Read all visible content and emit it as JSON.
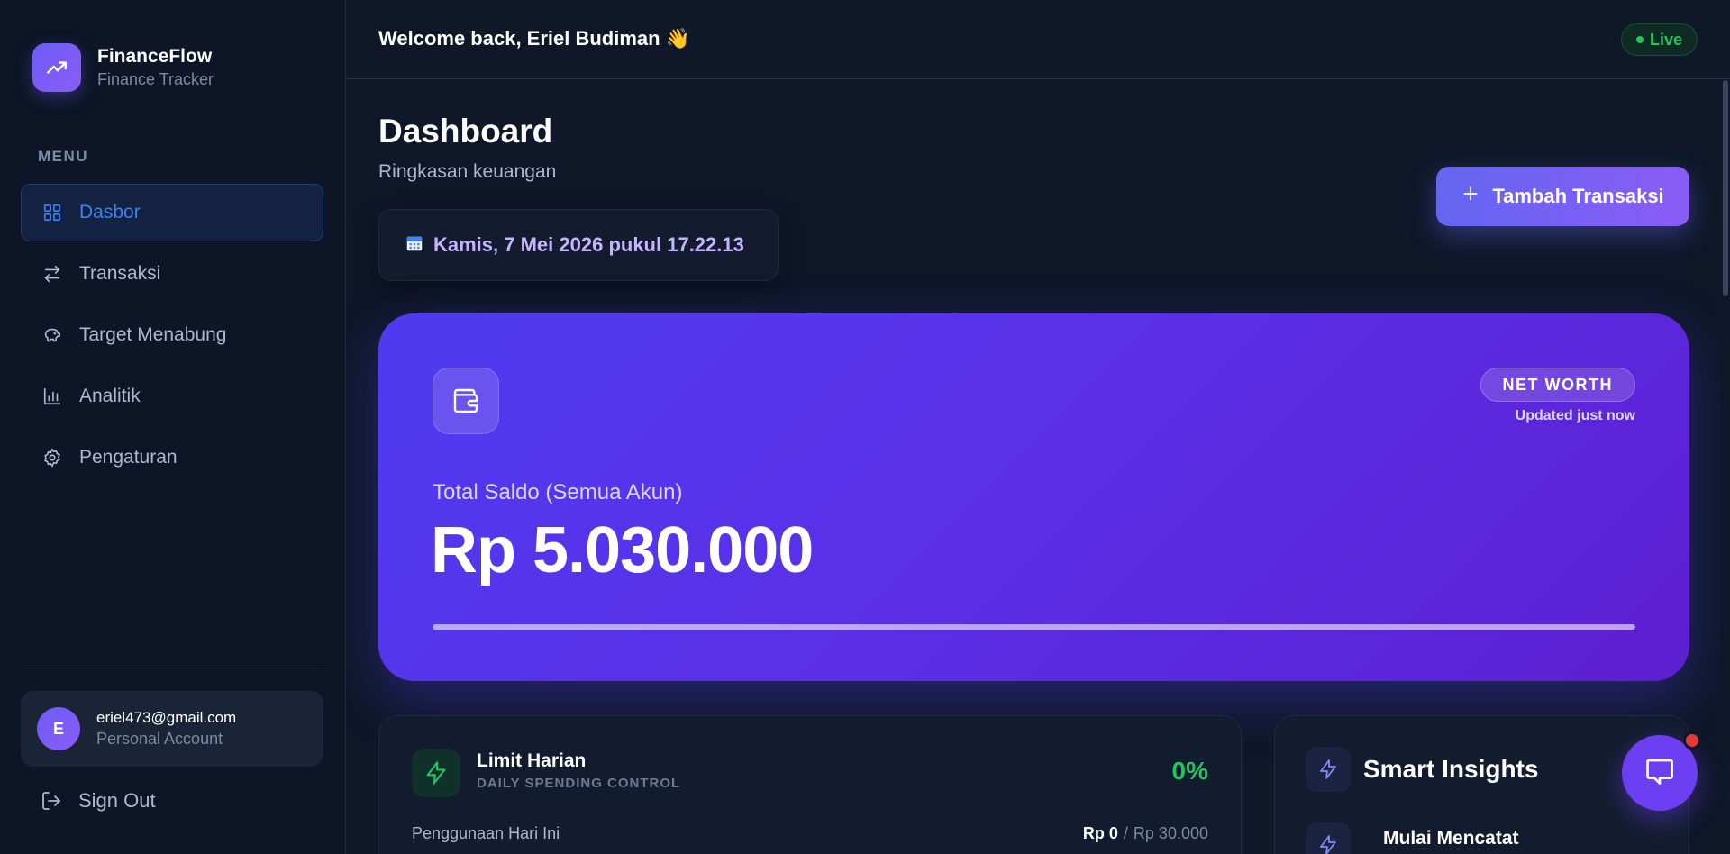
{
  "brand": {
    "name": "FinanceFlow",
    "subtitle": "Finance Tracker",
    "logo_icon": "trending-up-icon"
  },
  "sidebar": {
    "menu_label": "MENU",
    "items": [
      {
        "label": "Dasbor",
        "icon": "dashboard-grid-icon",
        "active": true
      },
      {
        "label": "Transaksi",
        "icon": "arrows-swap-icon",
        "active": false
      },
      {
        "label": "Target Menabung",
        "icon": "piggy-bank-icon",
        "active": false
      },
      {
        "label": "Analitik",
        "icon": "bar-chart-icon",
        "active": false
      },
      {
        "label": "Pengaturan",
        "icon": "gear-icon",
        "active": false
      }
    ],
    "account": {
      "initial": "E",
      "email": "eriel473@gmail.com",
      "type": "Personal Account"
    },
    "sign_out": "Sign Out"
  },
  "topbar": {
    "welcome": "Welcome back, Eriel Budiman 👋",
    "live": "Live"
  },
  "main": {
    "title": "Dashboard",
    "subtitle": "Ringkasan keuangan",
    "date": "Kamis, 7 Mei 2026 pukul 17.22.13",
    "add_button": "Tambah Transaksi"
  },
  "hero": {
    "badge": "NET WORTH",
    "updated": "Updated just now",
    "label": "Total Saldo (Semua Akun)",
    "amount": "Rp 5.030.000",
    "progress": 1.0
  },
  "limit": {
    "title": "Limit Harian",
    "subtitle": "DAILY SPENDING CONTROL",
    "percent": "0%",
    "usage_label": "Penggunaan Hari Ini",
    "current": "Rp 0",
    "separator": "/",
    "limit": "Rp 30.000"
  },
  "insights": {
    "title": "Smart Insights",
    "first_item": "Mulai Mencatat"
  },
  "colors": {
    "accent": "#6366f1",
    "active_nav": "#3b82f6",
    "success": "#22c55e",
    "hero_start": "#4f3bf0",
    "hero_end": "#5d1fd0"
  }
}
